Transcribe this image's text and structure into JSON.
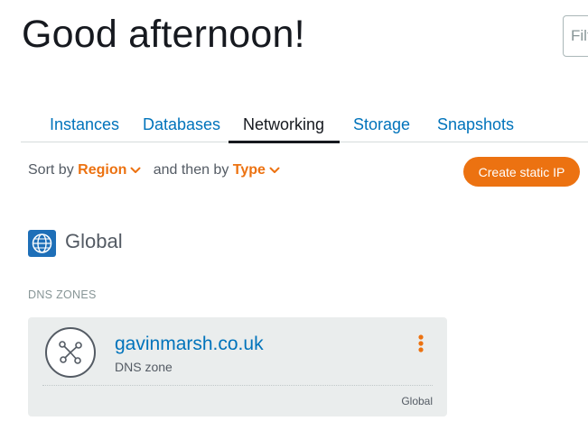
{
  "header": {
    "greeting": "Good afternoon!",
    "filter_placeholder": "Filter by name, location, tag, or type"
  },
  "tabs": [
    {
      "label": "Instances"
    },
    {
      "label": "Databases"
    },
    {
      "label": "Networking"
    },
    {
      "label": "Storage"
    },
    {
      "label": "Snapshots"
    }
  ],
  "active_tab": "Networking",
  "sort": {
    "prefix": "Sort by",
    "primary": "Region",
    "connector": "and then by",
    "secondary": "Type"
  },
  "actions": {
    "create_static_ip": "Create static IP"
  },
  "region": {
    "label": "Global",
    "icon": "globe-icon"
  },
  "dns_zones": {
    "section_label": "DNS ZONES",
    "items": [
      {
        "name": "gavinmarsh.co.uk",
        "type": "DNS zone",
        "region": "Global",
        "icon": "dns-zone-icon"
      }
    ]
  },
  "colors": {
    "accent_orange": "#ec7211",
    "link_blue": "#0073bb",
    "globe_blue": "#1e6fb8",
    "card_bg": "#eaeded"
  }
}
